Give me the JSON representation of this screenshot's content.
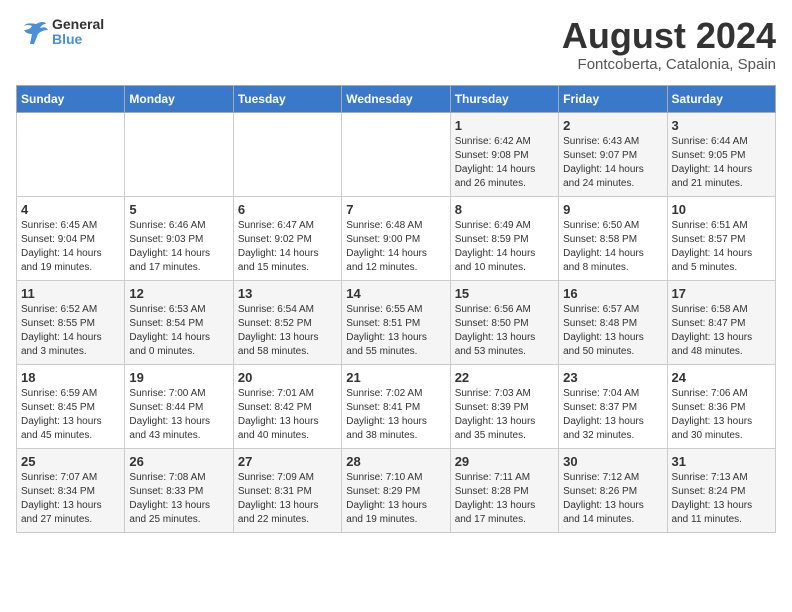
{
  "logo": {
    "text_general": "General",
    "text_blue": "Blue"
  },
  "title": "August 2024",
  "subtitle": "Fontcoberta, Catalonia, Spain",
  "days_of_week": [
    "Sunday",
    "Monday",
    "Tuesday",
    "Wednesday",
    "Thursday",
    "Friday",
    "Saturday"
  ],
  "weeks": [
    [
      {
        "day": "",
        "info": ""
      },
      {
        "day": "",
        "info": ""
      },
      {
        "day": "",
        "info": ""
      },
      {
        "day": "",
        "info": ""
      },
      {
        "day": "1",
        "info": "Sunrise: 6:42 AM\nSunset: 9:08 PM\nDaylight: 14 hours\nand 26 minutes."
      },
      {
        "day": "2",
        "info": "Sunrise: 6:43 AM\nSunset: 9:07 PM\nDaylight: 14 hours\nand 24 minutes."
      },
      {
        "day": "3",
        "info": "Sunrise: 6:44 AM\nSunset: 9:05 PM\nDaylight: 14 hours\nand 21 minutes."
      }
    ],
    [
      {
        "day": "4",
        "info": "Sunrise: 6:45 AM\nSunset: 9:04 PM\nDaylight: 14 hours\nand 19 minutes."
      },
      {
        "day": "5",
        "info": "Sunrise: 6:46 AM\nSunset: 9:03 PM\nDaylight: 14 hours\nand 17 minutes."
      },
      {
        "day": "6",
        "info": "Sunrise: 6:47 AM\nSunset: 9:02 PM\nDaylight: 14 hours\nand 15 minutes."
      },
      {
        "day": "7",
        "info": "Sunrise: 6:48 AM\nSunset: 9:00 PM\nDaylight: 14 hours\nand 12 minutes."
      },
      {
        "day": "8",
        "info": "Sunrise: 6:49 AM\nSunset: 8:59 PM\nDaylight: 14 hours\nand 10 minutes."
      },
      {
        "day": "9",
        "info": "Sunrise: 6:50 AM\nSunset: 8:58 PM\nDaylight: 14 hours\nand 8 minutes."
      },
      {
        "day": "10",
        "info": "Sunrise: 6:51 AM\nSunset: 8:57 PM\nDaylight: 14 hours\nand 5 minutes."
      }
    ],
    [
      {
        "day": "11",
        "info": "Sunrise: 6:52 AM\nSunset: 8:55 PM\nDaylight: 14 hours\nand 3 minutes."
      },
      {
        "day": "12",
        "info": "Sunrise: 6:53 AM\nSunset: 8:54 PM\nDaylight: 14 hours\nand 0 minutes."
      },
      {
        "day": "13",
        "info": "Sunrise: 6:54 AM\nSunset: 8:52 PM\nDaylight: 13 hours\nand 58 minutes."
      },
      {
        "day": "14",
        "info": "Sunrise: 6:55 AM\nSunset: 8:51 PM\nDaylight: 13 hours\nand 55 minutes."
      },
      {
        "day": "15",
        "info": "Sunrise: 6:56 AM\nSunset: 8:50 PM\nDaylight: 13 hours\nand 53 minutes."
      },
      {
        "day": "16",
        "info": "Sunrise: 6:57 AM\nSunset: 8:48 PM\nDaylight: 13 hours\nand 50 minutes."
      },
      {
        "day": "17",
        "info": "Sunrise: 6:58 AM\nSunset: 8:47 PM\nDaylight: 13 hours\nand 48 minutes."
      }
    ],
    [
      {
        "day": "18",
        "info": "Sunrise: 6:59 AM\nSunset: 8:45 PM\nDaylight: 13 hours\nand 45 minutes."
      },
      {
        "day": "19",
        "info": "Sunrise: 7:00 AM\nSunset: 8:44 PM\nDaylight: 13 hours\nand 43 minutes."
      },
      {
        "day": "20",
        "info": "Sunrise: 7:01 AM\nSunset: 8:42 PM\nDaylight: 13 hours\nand 40 minutes."
      },
      {
        "day": "21",
        "info": "Sunrise: 7:02 AM\nSunset: 8:41 PM\nDaylight: 13 hours\nand 38 minutes."
      },
      {
        "day": "22",
        "info": "Sunrise: 7:03 AM\nSunset: 8:39 PM\nDaylight: 13 hours\nand 35 minutes."
      },
      {
        "day": "23",
        "info": "Sunrise: 7:04 AM\nSunset: 8:37 PM\nDaylight: 13 hours\nand 32 minutes."
      },
      {
        "day": "24",
        "info": "Sunrise: 7:06 AM\nSunset: 8:36 PM\nDaylight: 13 hours\nand 30 minutes."
      }
    ],
    [
      {
        "day": "25",
        "info": "Sunrise: 7:07 AM\nSunset: 8:34 PM\nDaylight: 13 hours\nand 27 minutes."
      },
      {
        "day": "26",
        "info": "Sunrise: 7:08 AM\nSunset: 8:33 PM\nDaylight: 13 hours\nand 25 minutes."
      },
      {
        "day": "27",
        "info": "Sunrise: 7:09 AM\nSunset: 8:31 PM\nDaylight: 13 hours\nand 22 minutes."
      },
      {
        "day": "28",
        "info": "Sunrise: 7:10 AM\nSunset: 8:29 PM\nDaylight: 13 hours\nand 19 minutes."
      },
      {
        "day": "29",
        "info": "Sunrise: 7:11 AM\nSunset: 8:28 PM\nDaylight: 13 hours\nand 17 minutes."
      },
      {
        "day": "30",
        "info": "Sunrise: 7:12 AM\nSunset: 8:26 PM\nDaylight: 13 hours\nand 14 minutes."
      },
      {
        "day": "31",
        "info": "Sunrise: 7:13 AM\nSunset: 8:24 PM\nDaylight: 13 hours\nand 11 minutes."
      }
    ]
  ]
}
